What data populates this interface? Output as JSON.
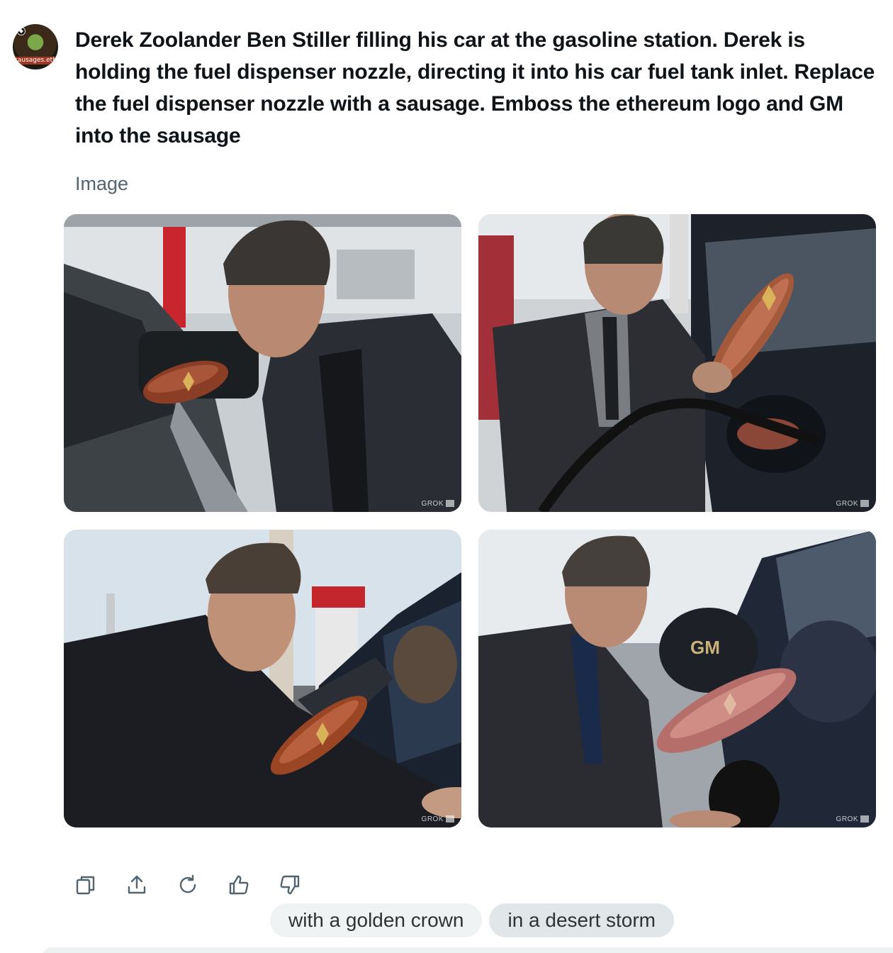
{
  "user": {
    "avatar_label": "sausages.eth"
  },
  "prompt": {
    "text": "Derek Zoolander Ben Stiller filling his car at the gasoline station. Derek is holding the fuel dispenser nozzle, directing it into his car fuel tank inlet. Replace the fuel dispenser nozzle with a sausage. Emboss the ethereum logo and GM into the sausage"
  },
  "section": {
    "label": "Image"
  },
  "images": [
    {
      "watermark": "GROK",
      "emboss": ""
    },
    {
      "watermark": "GROK",
      "emboss": ""
    },
    {
      "watermark": "GROK",
      "emboss": ""
    },
    {
      "watermark": "GROK",
      "emboss": "GM"
    }
  ],
  "actions": [
    {
      "icon": "copy-icon"
    },
    {
      "icon": "share-icon"
    },
    {
      "icon": "regenerate-icon"
    },
    {
      "icon": "thumbs-up-icon"
    },
    {
      "icon": "thumbs-down-icon"
    }
  ],
  "suggestions": [
    {
      "label": "with a golden crown"
    },
    {
      "label": "in a desert storm"
    }
  ],
  "colors": {
    "text_primary": "#0f1419",
    "text_secondary": "#536471",
    "chip_bg": "#eff3f4",
    "chip_bg_hover": "#e1e6e8",
    "icon": "#536471"
  }
}
